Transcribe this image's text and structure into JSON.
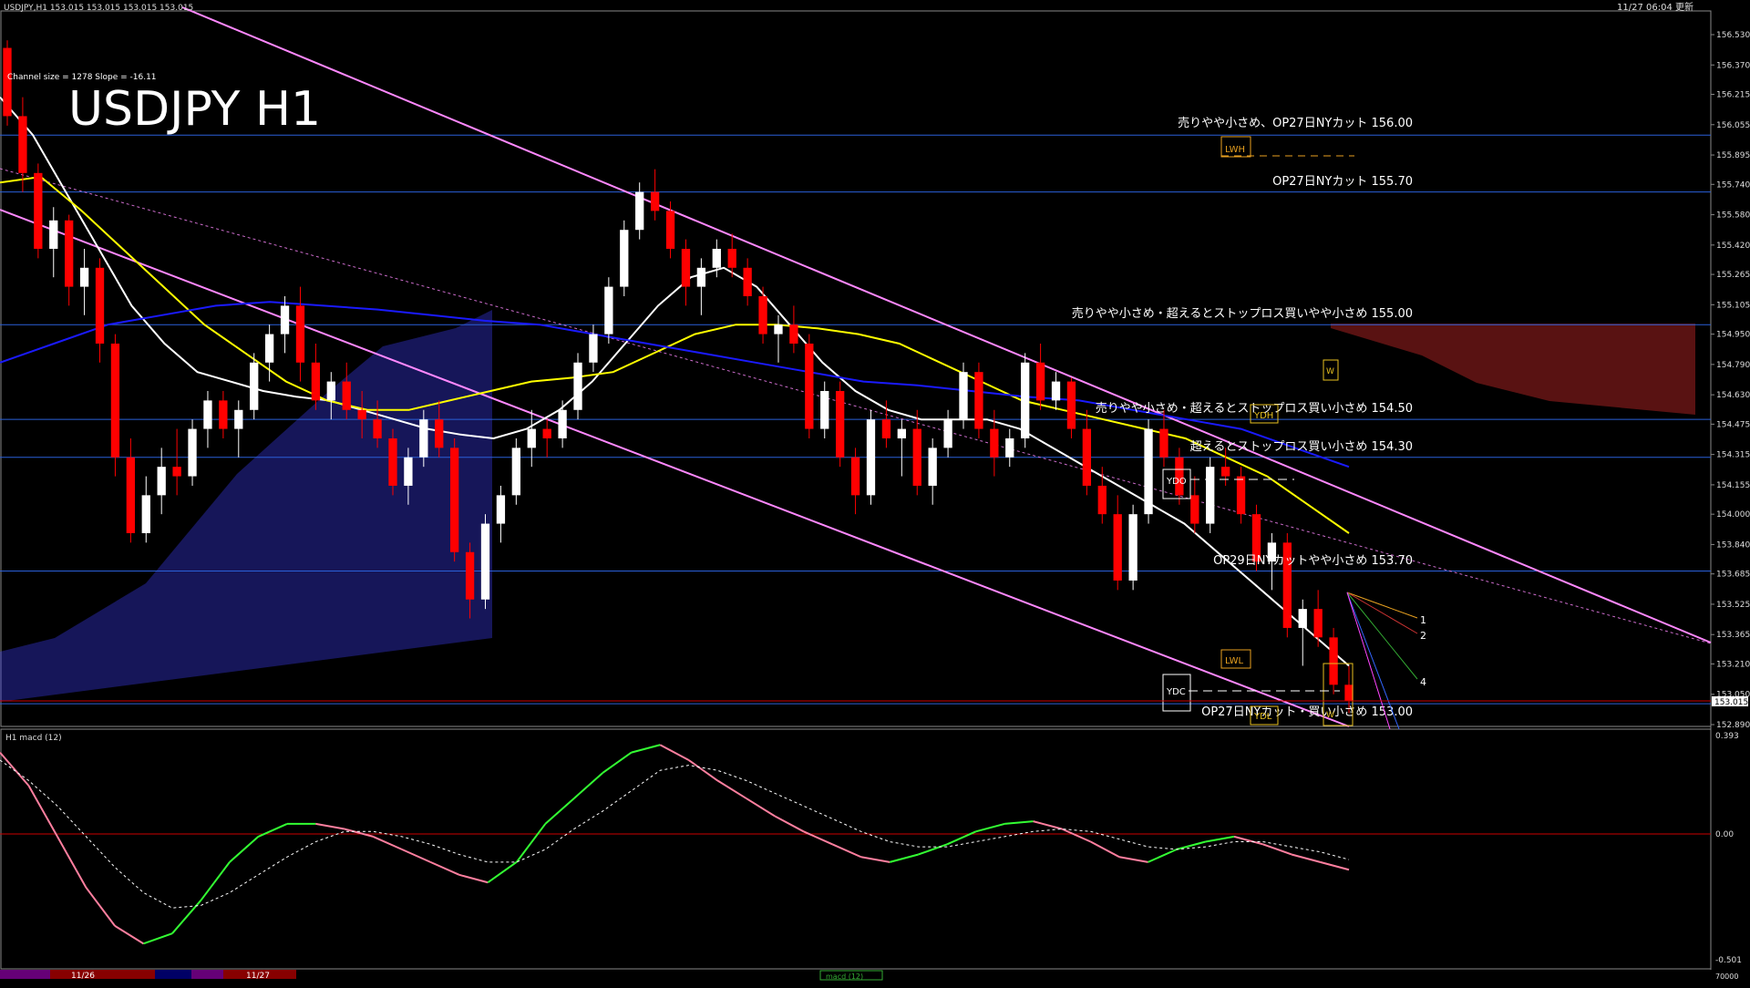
{
  "window": {
    "symbol_header": "USDJPY,H1  153.015 153.015 153.015 153.015",
    "datetime": "11/27 06:04 更新"
  },
  "main_title": "USDJPY H1",
  "channel_info": "Channel size = 1278 Slope = -16.11",
  "macd_header": "H1  macd (12)",
  "colors": {
    "background": "#000000",
    "candle_up": "#ffffff",
    "candle_down": "#ff0000",
    "ma_white": "#ffffff",
    "ma_yellow": "#ffff00",
    "ma_blue": "#1a1aff",
    "channel": "#ff88ff",
    "level_line": "#2a5fd8",
    "cloud_bull": "#4040ff",
    "cloud_bear": "#ff3333",
    "macd_up": "#33ff33",
    "macd_down": "#ff7f9f",
    "macd_signal": "#ffffff",
    "zero_line": "#cc0000"
  },
  "price_axis": {
    "ticks": [
      "156.530",
      "156.370",
      "156.215",
      "156.055",
      "155.895",
      "155.740",
      "155.580",
      "155.420",
      "155.265",
      "155.105",
      "154.950",
      "154.790",
      "154.630",
      "154.475",
      "154.315",
      "154.155",
      "154.000",
      "153.840",
      "153.685",
      "153.525",
      "153.365",
      "153.210",
      "153.050",
      "152.890"
    ],
    "current_price": "153.015"
  },
  "macd_axis": {
    "ticks": [
      "0.393",
      "0.00",
      "-0.501"
    ]
  },
  "levels": [
    {
      "label": "売りやや小さめ、OP27日NYカット 156.00",
      "price": 156.0
    },
    {
      "label": "OP27日NYカット 155.70",
      "price": 155.7
    },
    {
      "label": "売りやや小さめ・超えるとストップロス買いやや小さめ 155.00",
      "price": 155.0
    },
    {
      "label": "売りやや小さめ・超えるとストップロス買い小さめ 154.50",
      "price": 154.5
    },
    {
      "label": "超えるとストップロス買い小さめ 154.30",
      "price": 154.3
    },
    {
      "label": "OP29日NYカットやや小さめ 153.70",
      "price": 153.7
    },
    {
      "label": "OP27日NYカット・買い小さめ 153.00",
      "price": 153.0
    }
  ],
  "box_labels": [
    "LWH",
    "LWL",
    "YDH",
    "YDO",
    "YDC",
    "YDL",
    "W",
    "W"
  ],
  "projection_labels": [
    "1",
    "2",
    "4"
  ],
  "date_labels": [
    "11/26",
    "11/27"
  ],
  "macd_tag": "macd (12)",
  "bottom_right_value": "70000",
  "chart_data": {
    "type": "candlestick",
    "title": "USDJPY H1",
    "timeframe": "H1",
    "ylim": [
      152.89,
      156.53
    ],
    "candles": [
      [
        156.46,
        156.5,
        156.05,
        156.1
      ],
      [
        156.1,
        156.2,
        155.7,
        155.8
      ],
      [
        155.8,
        155.85,
        155.35,
        155.4
      ],
      [
        155.4,
        155.62,
        155.25,
        155.55
      ],
      [
        155.55,
        155.58,
        155.1,
        155.2
      ],
      [
        155.2,
        155.4,
        155.05,
        155.3
      ],
      [
        155.3,
        155.35,
        154.8,
        154.9
      ],
      [
        154.9,
        154.95,
        154.2,
        154.3
      ],
      [
        154.3,
        154.4,
        153.85,
        153.9
      ],
      [
        153.9,
        154.2,
        153.85,
        154.1
      ],
      [
        154.1,
        154.35,
        154.0,
        154.25
      ],
      [
        154.25,
        154.45,
        154.1,
        154.2
      ],
      [
        154.2,
        154.5,
        154.15,
        154.45
      ],
      [
        154.45,
        154.65,
        154.35,
        154.6
      ],
      [
        154.6,
        154.65,
        154.4,
        154.45
      ],
      [
        154.45,
        154.6,
        154.3,
        154.55
      ],
      [
        154.55,
        154.85,
        154.5,
        154.8
      ],
      [
        154.8,
        155.0,
        154.7,
        154.95
      ],
      [
        154.95,
        155.15,
        154.85,
        155.1
      ],
      [
        155.1,
        155.2,
        154.7,
        154.8
      ],
      [
        154.8,
        154.9,
        154.55,
        154.6
      ],
      [
        154.6,
        154.75,
        154.5,
        154.7
      ],
      [
        154.7,
        154.8,
        154.5,
        154.55
      ],
      [
        154.55,
        154.65,
        154.4,
        154.5
      ],
      [
        154.5,
        154.6,
        154.35,
        154.4
      ],
      [
        154.4,
        154.45,
        154.1,
        154.15
      ],
      [
        154.15,
        154.35,
        154.05,
        154.3
      ],
      [
        154.3,
        154.55,
        154.25,
        154.5
      ],
      [
        154.5,
        154.6,
        154.3,
        154.35
      ],
      [
        154.35,
        154.4,
        153.75,
        153.8
      ],
      [
        153.8,
        153.85,
        153.45,
        153.55
      ],
      [
        153.55,
        154.0,
        153.5,
        153.95
      ],
      [
        153.95,
        154.15,
        153.85,
        154.1
      ],
      [
        154.1,
        154.4,
        154.05,
        154.35
      ],
      [
        154.35,
        154.55,
        154.25,
        154.45
      ],
      [
        154.45,
        154.5,
        154.3,
        154.4
      ],
      [
        154.4,
        154.6,
        154.35,
        154.55
      ],
      [
        154.55,
        154.85,
        154.5,
        154.8
      ],
      [
        154.8,
        155.0,
        154.75,
        154.95
      ],
      [
        154.95,
        155.25,
        154.9,
        155.2
      ],
      [
        155.2,
        155.55,
        155.15,
        155.5
      ],
      [
        155.5,
        155.75,
        155.45,
        155.7
      ],
      [
        155.7,
        155.82,
        155.55,
        155.6
      ],
      [
        155.6,
        155.65,
        155.35,
        155.4
      ],
      [
        155.4,
        155.45,
        155.1,
        155.2
      ],
      [
        155.2,
        155.35,
        155.05,
        155.3
      ],
      [
        155.3,
        155.45,
        155.25,
        155.4
      ],
      [
        155.4,
        155.48,
        155.25,
        155.3
      ],
      [
        155.3,
        155.35,
        155.1,
        155.15
      ],
      [
        155.15,
        155.2,
        154.9,
        154.95
      ],
      [
        154.95,
        155.05,
        154.8,
        155.0
      ],
      [
        155.0,
        155.1,
        154.85,
        154.9
      ],
      [
        154.9,
        154.95,
        154.4,
        154.45
      ],
      [
        154.45,
        154.7,
        154.4,
        154.65
      ],
      [
        154.65,
        154.7,
        154.25,
        154.3
      ],
      [
        154.3,
        154.35,
        154.0,
        154.1
      ],
      [
        154.1,
        154.55,
        154.05,
        154.5
      ],
      [
        154.5,
        154.6,
        154.35,
        154.4
      ],
      [
        154.4,
        154.5,
        154.2,
        154.45
      ],
      [
        154.45,
        154.55,
        154.1,
        154.15
      ],
      [
        154.15,
        154.4,
        154.05,
        154.35
      ],
      [
        154.35,
        154.55,
        154.3,
        154.5
      ],
      [
        154.5,
        154.8,
        154.45,
        154.75
      ],
      [
        154.75,
        154.8,
        154.4,
        154.45
      ],
      [
        154.45,
        154.55,
        154.2,
        154.3
      ],
      [
        154.3,
        154.45,
        154.25,
        154.4
      ],
      [
        154.4,
        154.85,
        154.35,
        154.8
      ],
      [
        154.8,
        154.9,
        154.55,
        154.6
      ],
      [
        154.6,
        154.75,
        154.55,
        154.7
      ],
      [
        154.7,
        154.72,
        154.4,
        154.45
      ],
      [
        154.45,
        154.55,
        154.1,
        154.15
      ],
      [
        154.15,
        154.25,
        153.95,
        154.0
      ],
      [
        154.0,
        154.1,
        153.6,
        153.65
      ],
      [
        153.65,
        154.05,
        153.6,
        154.0
      ],
      [
        154.0,
        154.5,
        153.95,
        154.45
      ],
      [
        154.45,
        154.55,
        154.25,
        154.3
      ],
      [
        154.3,
        154.35,
        154.05,
        154.1
      ],
      [
        154.1,
        154.2,
        153.9,
        153.95
      ],
      [
        153.95,
        154.3,
        153.9,
        154.25
      ],
      [
        154.25,
        154.35,
        154.15,
        154.2
      ],
      [
        154.2,
        154.25,
        153.95,
        154.0
      ],
      [
        154.0,
        154.05,
        153.7,
        153.75
      ],
      [
        153.75,
        153.9,
        153.6,
        153.85
      ],
      [
        153.85,
        153.9,
        153.35,
        153.4
      ],
      [
        153.4,
        153.55,
        153.2,
        153.5
      ],
      [
        153.5,
        153.6,
        153.3,
        153.35
      ],
      [
        153.35,
        153.4,
        153.05,
        153.1
      ],
      [
        153.1,
        153.2,
        152.95,
        153.015
      ]
    ],
    "moving_averages": [
      {
        "color": "white",
        "values": [
          156.2,
          156.0,
          155.7,
          155.4,
          155.1,
          154.9,
          154.75,
          154.7,
          154.65,
          154.62,
          154.6,
          154.55,
          154.5,
          154.45,
          154.42,
          154.4,
          154.45,
          154.55,
          154.7,
          154.9,
          155.1,
          155.25,
          155.3,
          155.2,
          155.0,
          154.8,
          154.65,
          154.55,
          154.5,
          154.5,
          154.5,
          154.45,
          154.35,
          154.25,
          154.15,
          154.05,
          153.95,
          153.8,
          153.65,
          153.5,
          153.35,
          153.2
        ]
      },
      {
        "color": "yellow",
        "values": [
          155.75,
          155.78,
          155.6,
          155.4,
          155.2,
          155.0,
          154.85,
          154.7,
          154.6,
          154.55,
          154.55,
          154.6,
          154.65,
          154.7,
          154.72,
          154.75,
          154.85,
          154.95,
          155.0,
          155.0,
          154.98,
          154.95,
          154.9,
          154.8,
          154.7,
          154.6,
          154.55,
          154.5,
          154.45,
          154.4,
          154.3,
          154.2,
          154.05,
          153.9
        ]
      },
      {
        "color": "blue",
        "values": [
          154.8,
          154.9,
          155.0,
          155.05,
          155.1,
          155.12,
          155.1,
          155.08,
          155.05,
          155.02,
          155.0,
          154.95,
          154.9,
          154.85,
          154.8,
          154.75,
          154.7,
          154.68,
          154.65,
          154.62,
          154.6,
          154.55,
          154.5,
          154.45,
          154.35,
          154.25
        ]
      }
    ],
    "channel": {
      "size": 1278,
      "slope": -16.11
    },
    "macd": {
      "ylim": [
        -0.501,
        0.393
      ],
      "macd_line": [
        0.33,
        0.2,
        0.0,
        -0.2,
        -0.35,
        -0.42,
        -0.38,
        -0.25,
        -0.1,
        0.0,
        0.05,
        0.05,
        0.03,
        0.0,
        -0.05,
        -0.1,
        -0.15,
        -0.18,
        -0.1,
        0.05,
        0.15,
        0.25,
        0.33,
        0.36,
        0.3,
        0.22,
        0.15,
        0.08,
        0.02,
        -0.03,
        -0.08,
        -0.1,
        -0.07,
        -0.03,
        0.02,
        0.05,
        0.06,
        0.03,
        -0.02,
        -0.08,
        -0.1,
        -0.05,
        -0.02,
        0.0,
        -0.03,
        -0.07,
        -0.1,
        -0.13
      ],
      "signal_line": [
        0.3,
        0.22,
        0.12,
        0.0,
        -0.12,
        -0.22,
        -0.28,
        -0.27,
        -0.22,
        -0.15,
        -0.08,
        -0.02,
        0.02,
        0.02,
        0.0,
        -0.03,
        -0.07,
        -0.1,
        -0.1,
        -0.05,
        0.03,
        0.1,
        0.18,
        0.26,
        0.28,
        0.26,
        0.22,
        0.17,
        0.12,
        0.07,
        0.02,
        -0.02,
        -0.04,
        -0.04,
        -0.02,
        0.0,
        0.02,
        0.03,
        0.02,
        -0.01,
        -0.04,
        -0.05,
        -0.04,
        -0.02,
        -0.02,
        -0.04,
        -0.06,
        -0.09
      ]
    }
  }
}
